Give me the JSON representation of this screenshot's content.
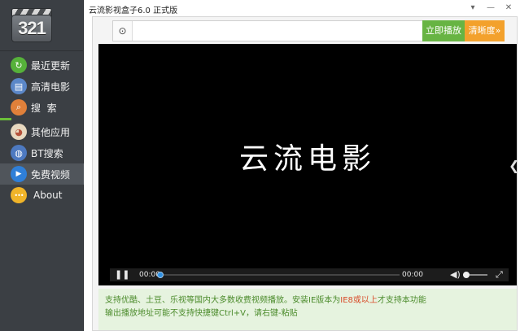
{
  "window": {
    "title": "云流影视盒子6.0 正式版",
    "controls": {
      "menu": "▾",
      "minimize": "—",
      "close": "✕"
    }
  },
  "sidebar": {
    "logo_number": "321",
    "items": [
      {
        "label": "最近更新",
        "icon": "refresh-icon",
        "color": "#56b13a",
        "glyph": "↻"
      },
      {
        "label": "高清电影",
        "icon": "film-icon",
        "color": "#5b87c8",
        "glyph": "▤"
      },
      {
        "label": "搜  索",
        "icon": "search-icon",
        "color": "#e0803a",
        "glyph": "⌕"
      },
      {
        "label": "其他应用",
        "icon": "apps-icon",
        "color": "#e8d9c0",
        "glyph": "◕"
      },
      {
        "label": "BT搜索",
        "icon": "globe-icon",
        "color": "#4d79c0",
        "glyph": "◍"
      },
      {
        "label": "免费视频",
        "icon": "play-icon",
        "color": "#2f7fd8",
        "glyph": "▶"
      },
      {
        "label": "About",
        "icon": "more-icon",
        "color": "#f0b429",
        "glyph": "•••"
      }
    ],
    "active_index": 5,
    "accent_color": "#6bbf3a"
  },
  "toolbar": {
    "url_icon": "target-icon",
    "url_icon_glyph": "⊙",
    "url_value": "",
    "url_placeholder": "",
    "play_label": "立即播放",
    "quality_label": "清晰度»",
    "play_color": "#67b443",
    "quality_color": "#f3a12c"
  },
  "player": {
    "video_title": "云流电影",
    "side_arrow": "❮",
    "pause_glyph": "❚❚",
    "current_time": "00:00",
    "total_time": "00:00",
    "progress": 0,
    "volume": 0,
    "volume_glyph": "◀)",
    "fullscreen_glyph": "⤢"
  },
  "notice": {
    "line1_a": "支持优酷、土豆、乐视等国内大多数收费视频播放。安装IE版本为",
    "line1_hl": "IE8或以上",
    "line1_b": "才支持本功能",
    "line2": "输出播放地址可能不支持快捷键Ctrl+V，请右键-粘贴"
  }
}
